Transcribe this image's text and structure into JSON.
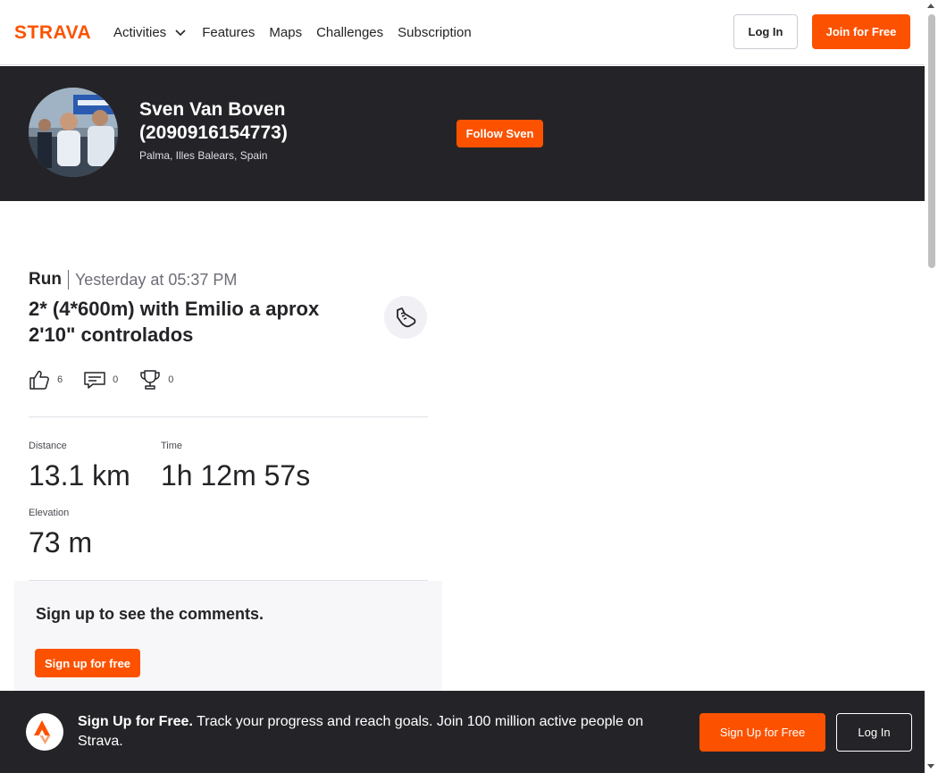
{
  "nav": {
    "logo_text": "STRAVA",
    "links": [
      "Activities",
      "Features",
      "Maps",
      "Challenges",
      "Subscription"
    ],
    "login_label": "Log In",
    "join_label": "Join for Free"
  },
  "profile": {
    "name": "Sven Van Boven (2090916154773)",
    "location": "Palma, Illes Balears, Spain",
    "follow_label": "Follow Sven"
  },
  "activity": {
    "type": "Run",
    "date": "Yesterday at 05:37 PM",
    "title": "2* (4*600m) with Emilio a aprox 2'10\" controlados",
    "kudos": "6",
    "comments": "0",
    "achievements": "0",
    "stats": {
      "distance_label": "Distance",
      "distance_value": "13.1 km",
      "time_label": "Time",
      "time_value": "1h 12m 57s",
      "elevation_label": "Elevation",
      "elevation_value": "73 m"
    }
  },
  "comments_section": {
    "prompt": "Sign up to see the comments.",
    "signup_label": "Sign up for free"
  },
  "banner": {
    "bold_text": "Sign Up for Free.",
    "text": " Track your progress and reach goals. Join 100 million active people on Strava.",
    "signup_label": "Sign Up for Free",
    "login_label": "Log In"
  },
  "colors": {
    "brand": "#fc5200",
    "dark": "#242428"
  }
}
